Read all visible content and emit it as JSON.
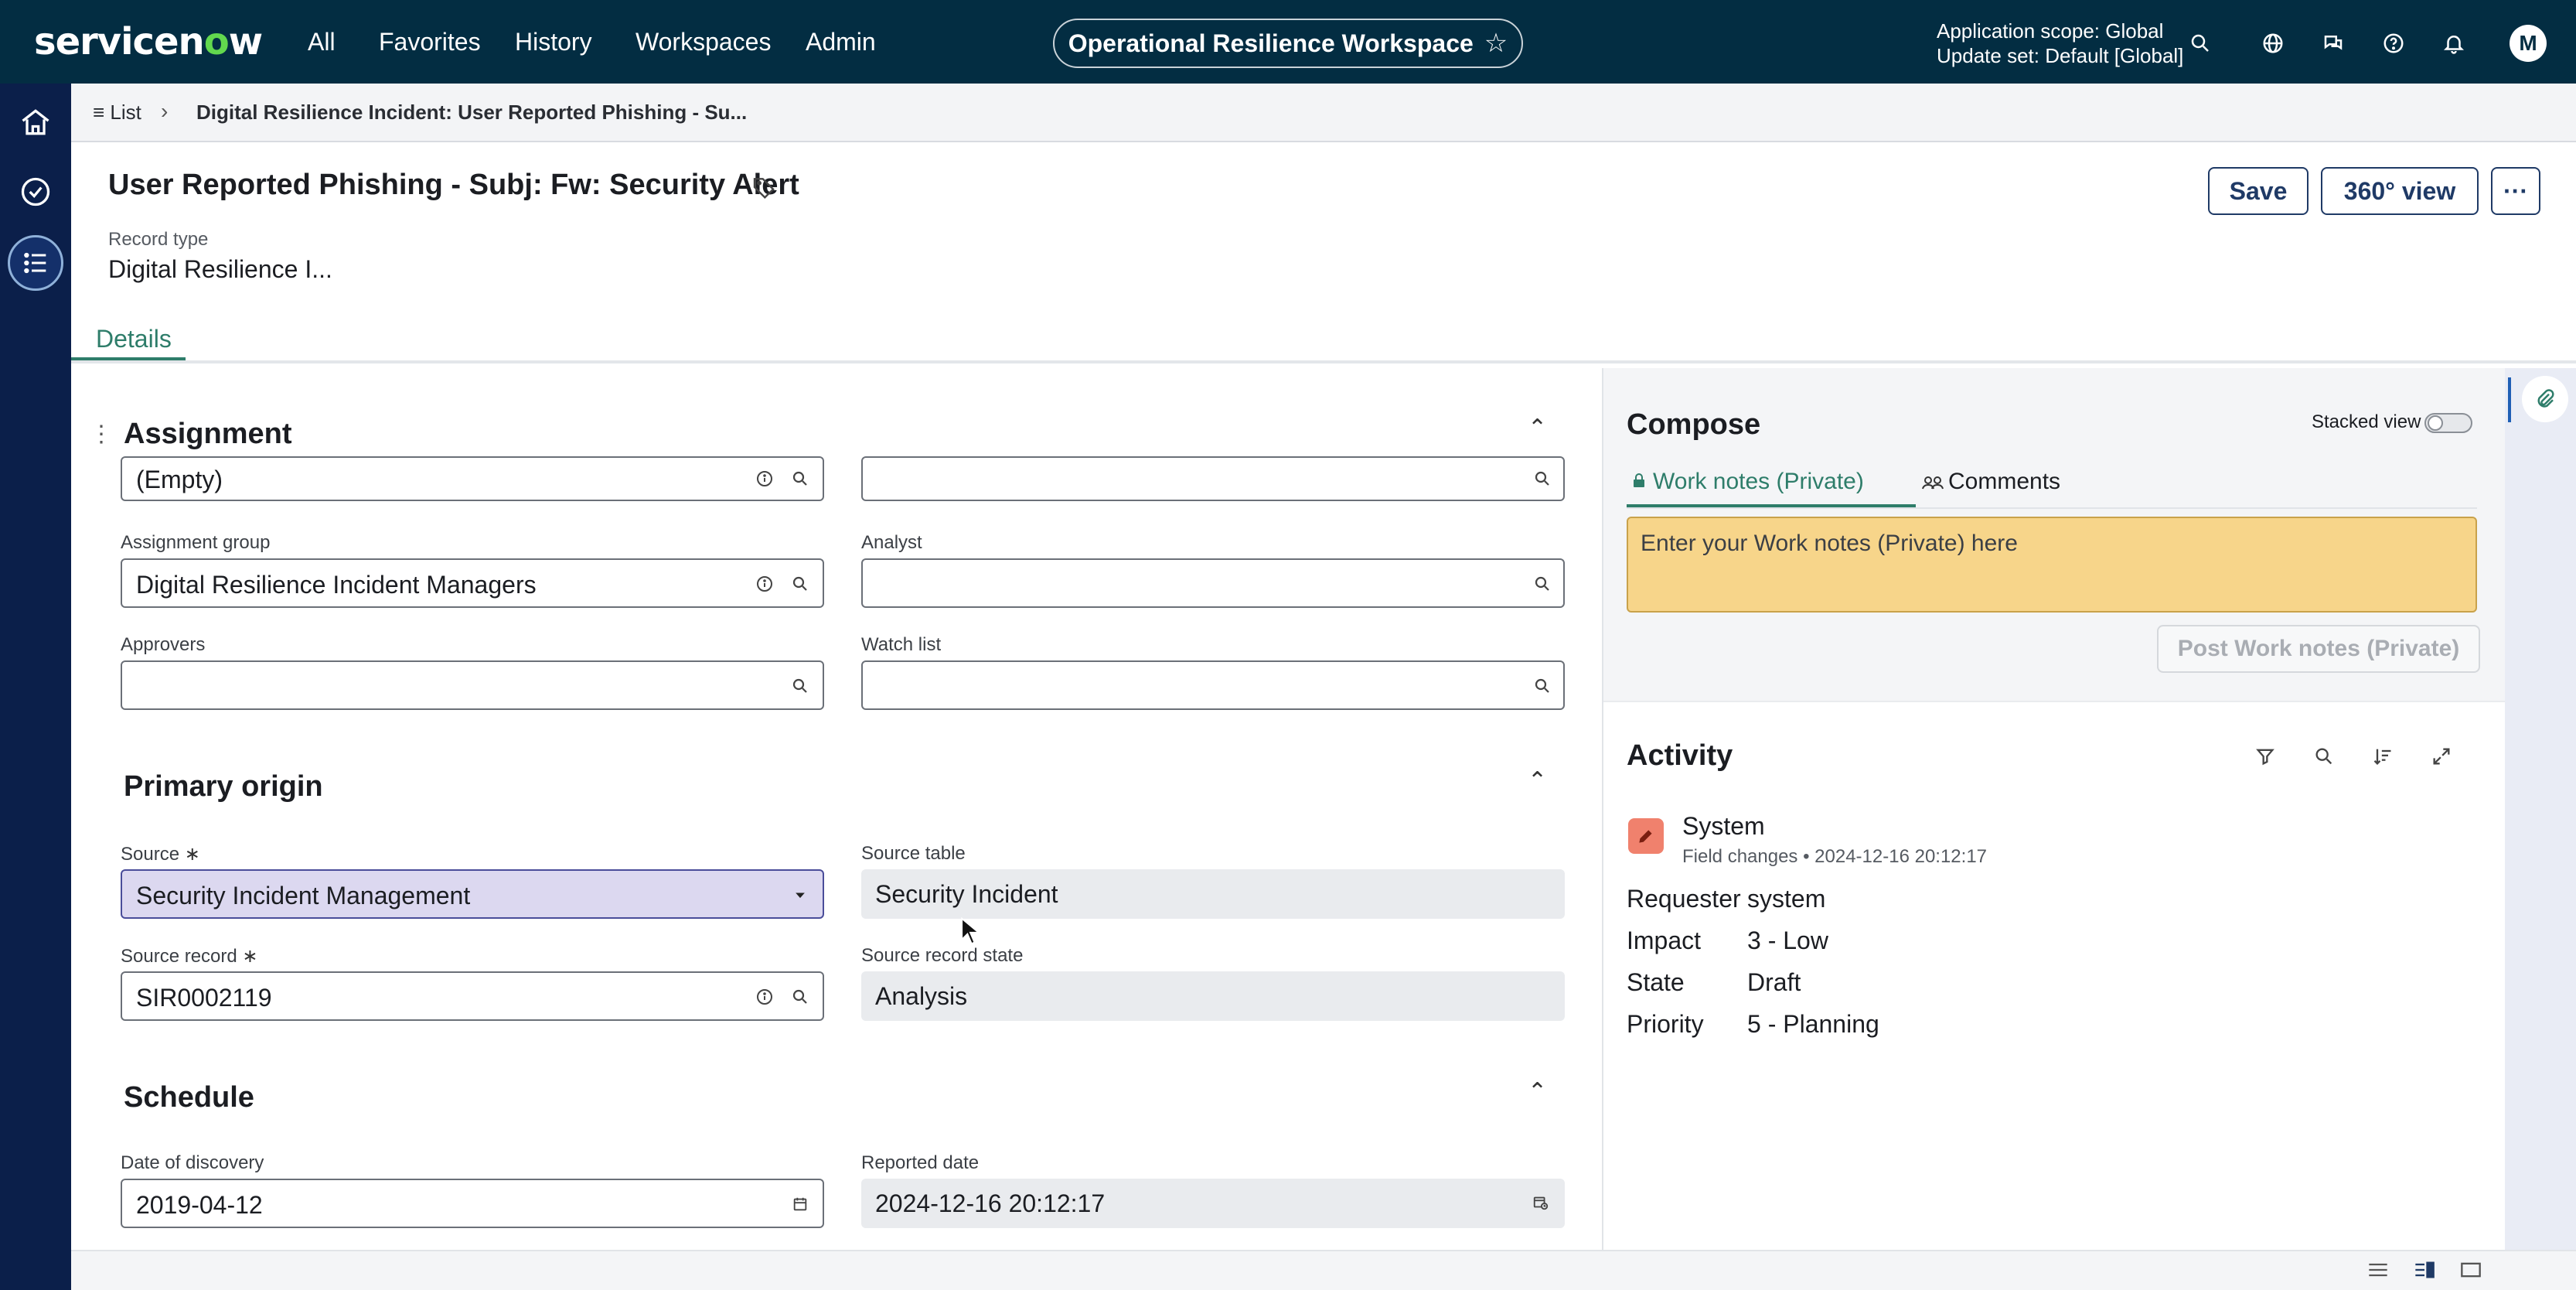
{
  "topbar": {
    "logo": "servicenow",
    "nav": [
      "All",
      "Favorites",
      "History",
      "Workspaces",
      "Admin"
    ],
    "workspace_title": "Operational Resilience Workspace",
    "scope_line1": "Application scope: Global",
    "scope_line2": "Update set: Default [Global]",
    "avatar_initial": "M"
  },
  "breadcrumb": {
    "list_label": "List",
    "separator": "›",
    "current": "Digital Resilience Incident: User Reported Phishing - Su..."
  },
  "record": {
    "title": "User Reported Phishing - Subj: Fw: Security Alert",
    "record_type_label": "Record type",
    "record_type_value": "Digital Resilience I...",
    "save_label": "Save",
    "view360_label": "360° view",
    "more_label": "···",
    "tab_details": "Details"
  },
  "assignment": {
    "title": "Assignment",
    "field1_value": "(Empty)",
    "field2_value": "",
    "assignment_group_label": "Assignment group",
    "assignment_group_value": "Digital Resilience Incident Managers",
    "analyst_label": "Analyst",
    "analyst_value": "",
    "approvers_label": "Approvers",
    "approvers_value": "",
    "watchlist_label": "Watch list",
    "watchlist_value": ""
  },
  "primary_origin": {
    "title": "Primary origin",
    "source_label": "Source",
    "source_value": "Security Incident Management",
    "source_table_label": "Source table",
    "source_table_value": "Security Incident",
    "source_record_label": "Source record",
    "source_record_value": "SIR0002119",
    "source_record_state_label": "Source record state",
    "source_record_state_value": "Analysis"
  },
  "schedule": {
    "title": "Schedule",
    "date_discovery_label": "Date of discovery",
    "date_discovery_value": "2019-04-12",
    "reported_date_label": "Reported date",
    "reported_date_value": "2024-12-16 20:12:17"
  },
  "compose": {
    "title": "Compose",
    "stacked_view_label": "Stacked view",
    "tab_work_notes": "Work notes (Private)",
    "tab_comments": "Comments",
    "work_notes_placeholder": "Enter your Work notes (Private) here",
    "post_button": "Post Work notes (Private)"
  },
  "activity": {
    "title": "Activity",
    "user": "System",
    "meta": "Field changes • 2024-12-16 20:12:17",
    "entries": [
      {
        "key": "Requester",
        "value": "system"
      },
      {
        "key": "Impact",
        "value": "3 - Low"
      },
      {
        "key": "State",
        "value": "Draft"
      },
      {
        "key": "Priority",
        "value": "5 - Planning"
      }
    ]
  },
  "colors": {
    "topbar": "#032d42",
    "leftrail": "#0b1f4a",
    "accent_green": "#2e7d6a",
    "work_notes_bg": "#f7d58a",
    "source_select_bg": "#dcd8f0"
  },
  "icons": [
    "home-icon",
    "check-circle-icon",
    "list-icon",
    "search-icon",
    "globe-icon",
    "chat-icon",
    "help-icon",
    "bell-icon",
    "tag-icon",
    "info-icon",
    "chevron-up-icon",
    "caret-down-icon",
    "calendar-icon",
    "lock-icon",
    "people-icon",
    "filter-icon",
    "sort-icon",
    "expand-icon",
    "pencil-icon",
    "paperclip-icon"
  ]
}
